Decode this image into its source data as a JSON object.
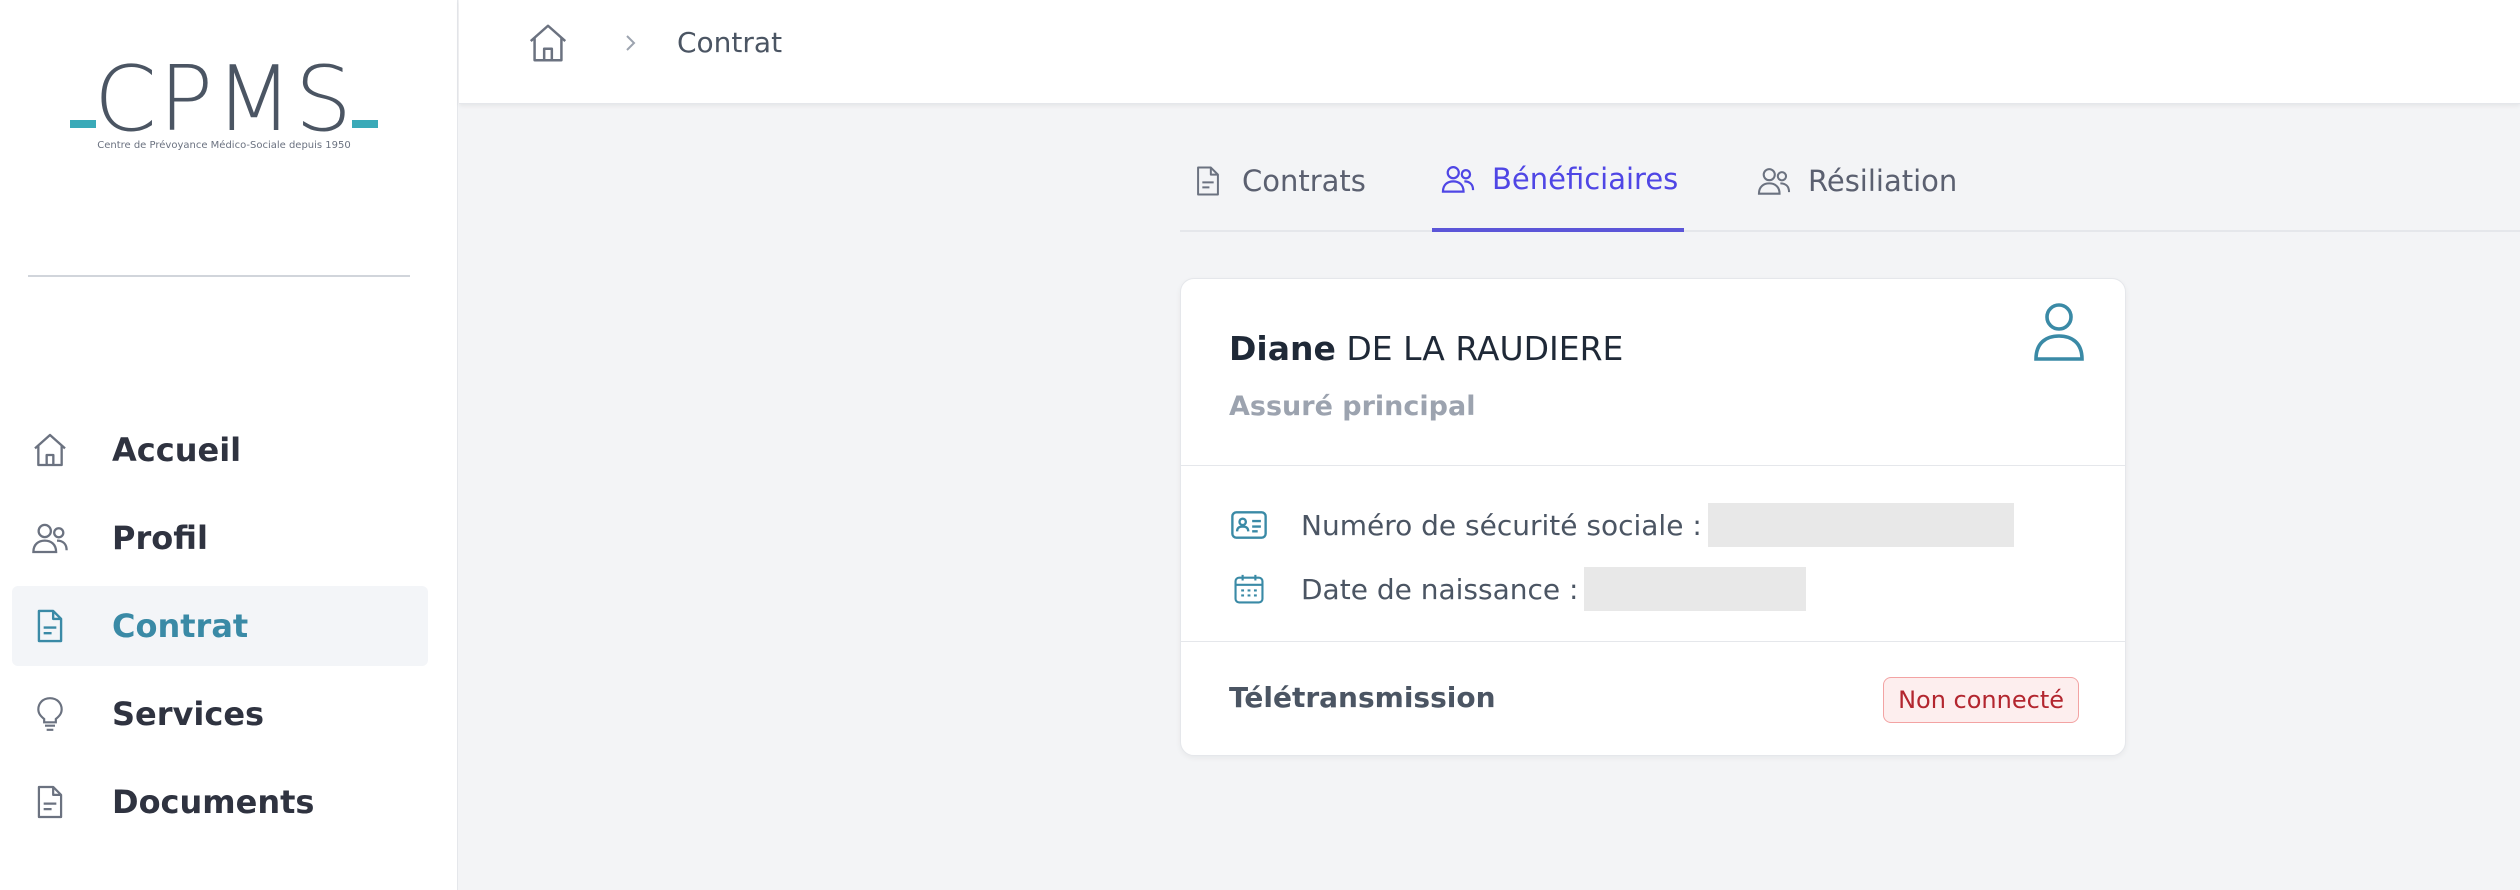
{
  "logo": {
    "text": "CPMS",
    "tagline": "Centre de Prévoyance Médico-Sociale depuis 1950"
  },
  "sidebar": {
    "items": [
      {
        "label": "Accueil",
        "icon": "home-icon"
      },
      {
        "label": "Profil",
        "icon": "users-icon"
      },
      {
        "label": "Contrat",
        "icon": "document-icon",
        "active": true
      },
      {
        "label": "Services",
        "icon": "lightbulb-icon"
      },
      {
        "label": "Documents",
        "icon": "document-icon"
      }
    ]
  },
  "breadcrumb": {
    "current": "Contrat"
  },
  "tabs": [
    {
      "label": "Contrats",
      "icon": "document-icon"
    },
    {
      "label": "Bénéficiaires",
      "icon": "users-icon",
      "active": true
    },
    {
      "label": "Résiliation",
      "icon": "users-icon"
    }
  ],
  "beneficiary": {
    "first_name": "Diane",
    "last_name": "DE LA RAUDIERE",
    "role": "Assuré principal",
    "ssn_label": "Numéro de sécurité sociale :",
    "birth_label": "Date de naissance :",
    "teletransmission_label": "Télétransmission",
    "teletransmission_status": "Non connecté"
  },
  "colors": {
    "accent": "#3a8aa6",
    "tab_active": "#4f46e5",
    "logo_dash": "#3aaab8",
    "badge_text": "#b3262f",
    "badge_bg": "#fdeeee"
  }
}
